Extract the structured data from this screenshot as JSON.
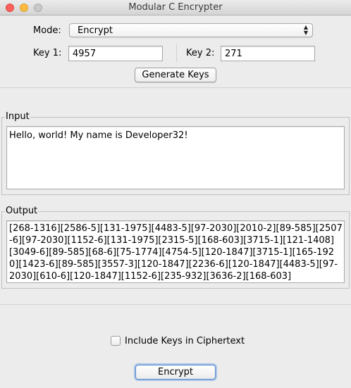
{
  "window": {
    "title": "Modular C Encrypter"
  },
  "mode": {
    "label": "Mode:",
    "selected": "Encrypt"
  },
  "keys": {
    "key1_label": "Key 1:",
    "key1_value": "4957",
    "key2_label": "Key 2:",
    "key2_value": "271",
    "generate_label": "Generate Keys"
  },
  "input": {
    "group_title": "Input",
    "text": "Hello, world! My name is Developer32!"
  },
  "output": {
    "group_title": "Output",
    "text": "[268-1316][2586-5][131-1975][4483-5][97-2030][2010-2][89-585][2507-6][97-2030][1152-6][131-1975][2315-5][168-603][3715-1][121-1408][3049-6][89-585][68-6][75-1774][4754-5][120-1847][3715-1][165-1920][1423-6][89-585][3557-3][120-1847][2236-6][120-1847][4483-5][97-2030][610-6][120-1847][1152-6][235-932][3636-2][168-603]"
  },
  "options": {
    "include_keys_label": "Include Keys in Ciphertext",
    "include_keys_checked": false
  },
  "action": {
    "button_label": "Encrypt"
  }
}
